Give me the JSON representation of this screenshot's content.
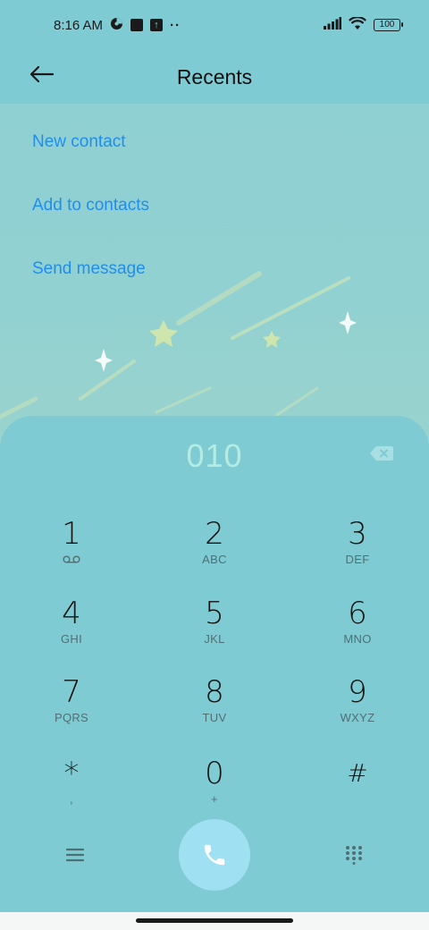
{
  "status_bar": {
    "time": "8:16 AM",
    "battery": "100",
    "icons": [
      "theme-icon",
      "square-app-icon",
      "upload-app-icon",
      "more-dots-icon",
      "signal-icon",
      "wifi-icon",
      "battery-icon"
    ],
    "dots": "··"
  },
  "header": {
    "title": "Recents",
    "back_icon": "arrow-left-icon"
  },
  "actions": {
    "new_contact": "New contact",
    "add_to_contacts": "Add to contacts",
    "send_message": "Send message"
  },
  "dialpad": {
    "entered_number": "010",
    "backspace_icon": "backspace-icon",
    "keys": [
      {
        "digit": "1",
        "sub": ""
      },
      {
        "digit": "2",
        "sub": "ABC"
      },
      {
        "digit": "3",
        "sub": "DEF"
      },
      {
        "digit": "4",
        "sub": "GHI"
      },
      {
        "digit": "5",
        "sub": "JKL"
      },
      {
        "digit": "6",
        "sub": "MNO"
      },
      {
        "digit": "7",
        "sub": "PQRS"
      },
      {
        "digit": "8",
        "sub": "TUV"
      },
      {
        "digit": "9",
        "sub": "WXYZ"
      },
      {
        "digit": "*",
        "sub": ","
      },
      {
        "digit": "0",
        "sub": "+"
      },
      {
        "digit": "#",
        "sub": ""
      }
    ]
  },
  "bottom_bar": {
    "menu_icon": "menu-icon",
    "call_icon": "phone-icon",
    "keypad_icon": "dialpad-grid-icon"
  },
  "colors": {
    "background": "#7fcbd3",
    "accent": "#1f8ef0",
    "call_button": "#9fe0f2",
    "number_text": "#b4ebe3"
  }
}
